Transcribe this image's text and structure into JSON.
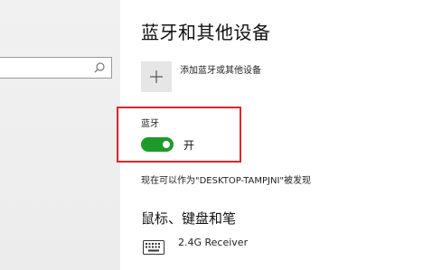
{
  "sidebar": {
    "search": {
      "placeholder": "",
      "icon": "search-icon"
    }
  },
  "main": {
    "title": "蓝牙和其他设备",
    "add_device": {
      "label": "添加蓝牙或其他设备",
      "icon": "plus-icon"
    },
    "bluetooth": {
      "label": "蓝牙",
      "toggle_state_text": "开",
      "is_on": true,
      "toggle_color": "#1d9a2a"
    },
    "discoverable_text": "现在可以作为\"DESKTOP-TAMPJNI\"被发现",
    "devices_section": {
      "title": "鼠标、键盘和笔",
      "devices": [
        {
          "name": "2.4G Receiver",
          "icon": "keyboard-icon"
        }
      ]
    }
  },
  "annotation": {
    "highlight_color": "#e0242c"
  }
}
